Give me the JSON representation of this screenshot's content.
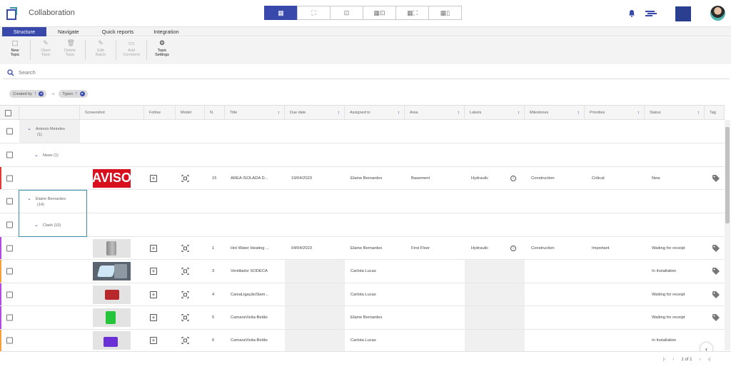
{
  "app": {
    "title": "Collaboration"
  },
  "tabs": [
    "Structure",
    "Navigate",
    "Quick reports",
    "Integration"
  ],
  "toolbar": {
    "new_topic": "New\nTopic",
    "open_topic": "Open\nTopic",
    "delete_topic": "Delete\nTopic",
    "edit_batch": "Edit\nBatch",
    "add_comment": "Add\nComment",
    "topic_settings": "Topic\nSettings"
  },
  "search": {
    "placeholder": "Search"
  },
  "chips": [
    {
      "label": "Created by"
    },
    {
      "label": "Types"
    }
  ],
  "columns": [
    "Screenshot",
    "Follow",
    "Model",
    "N.",
    "Title",
    "Due date",
    "Assigned to",
    "Area",
    "Labels",
    "Milestones",
    "Priorities",
    "Status",
    "Tag"
  ],
  "groups": {
    "g1": {
      "name": "Antonio Meireles",
      "count": "(1)"
    },
    "g1_sub": {
      "name": "News (1)"
    },
    "g2": {
      "name": "Elaine Bernardes",
      "count": "(14)"
    },
    "g2_sub": {
      "name": "Clash (10)"
    }
  },
  "rows": [
    {
      "n": "15",
      "title": "ÁREA ISOLADA D...",
      "due": "19/04/2023",
      "assigned": "Elaine Bernardes",
      "area": "Basement",
      "labels": "Hydraulic",
      "milestone": "Construction",
      "priority": "Critical",
      "status": "New",
      "thumb_text": "AVISO"
    },
    {
      "n": "1",
      "title": "Hot Water Heating ...",
      "due": "04/04/2023",
      "assigned": "Elaine Bernardes",
      "area": "First Floor",
      "labels": "Hydraulic",
      "milestone": "Construction",
      "priority": "Important",
      "status": "Waiting for receipt"
    },
    {
      "n": "3",
      "title": "Ventilador SODECA",
      "due": "",
      "assigned": "Carlota Lucas",
      "area": "",
      "labels": "",
      "milestone": "",
      "priority": "",
      "status": "In Installation"
    },
    {
      "n": "4",
      "title": "CaixaLigaçãoSlam...",
      "due": "",
      "assigned": "Carlota Lucas",
      "area": "",
      "labels": "",
      "milestone": "",
      "priority": "",
      "status": "Waiting for receipt"
    },
    {
      "n": "5",
      "title": "CamaraVisita-Betão",
      "due": "",
      "assigned": "Elaine Bernardes",
      "area": "",
      "labels": "",
      "milestone": "",
      "priority": "",
      "status": "Waiting for receipt"
    },
    {
      "n": "6",
      "title": "CamaraVisita-Betão",
      "due": "",
      "assigned": "Carlota Lucas",
      "area": "",
      "labels": "",
      "milestone": "",
      "priority": "",
      "status": "In Installation"
    }
  ],
  "pager": {
    "text": "1 of 1"
  },
  "colors": {
    "accent": "#3949ab",
    "critical_bar": "#e53935",
    "purple_bar": "#b04ae0",
    "orange_bar": "#f5a03a"
  }
}
